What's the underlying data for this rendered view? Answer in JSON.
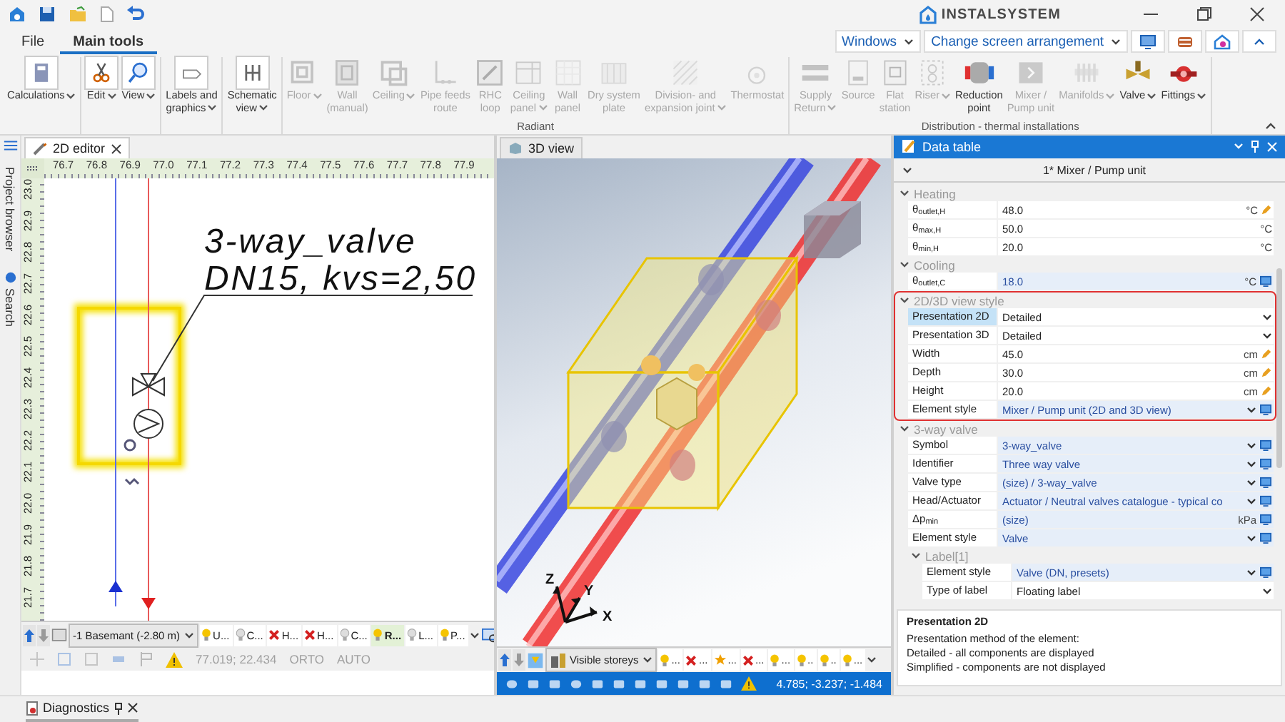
{
  "title_bar": {
    "logo": "INSTALSYSTEM"
  },
  "menu_tabs": [
    {
      "label": "File",
      "selected": false
    },
    {
      "label": "Main tools",
      "selected": true
    }
  ],
  "arrangement": {
    "windows": "Windows",
    "screen": "Change screen arrangement"
  },
  "ribbon": {
    "groups": [
      {
        "buttons": [
          {
            "label": "Calculations",
            "dropdown": true,
            "disabled": false
          }
        ]
      },
      {
        "buttons": [
          {
            "label": "Edit",
            "dropdown": true,
            "disabled": false
          },
          {
            "label": "View",
            "dropdown": true,
            "disabled": false
          }
        ]
      },
      {
        "buttons": [
          {
            "label": "Labels and\ngraphics",
            "dropdown": true,
            "disabled": false
          }
        ]
      },
      {
        "buttons": [
          {
            "label": "Schematic\nview",
            "dropdown": true,
            "disabled": false
          }
        ]
      },
      {
        "label": "Radiant",
        "buttons": [
          {
            "label": "Floor",
            "dropdown": true,
            "disabled": true
          },
          {
            "label": "Wall\n(manual)",
            "dropdown": false,
            "disabled": true
          },
          {
            "label": "Ceiling",
            "dropdown": true,
            "disabled": true
          },
          {
            "label": "Pipe feeds\nroute",
            "dropdown": false,
            "disabled": true
          },
          {
            "label": "RHC\nloop",
            "dropdown": false,
            "disabled": true
          },
          {
            "label": "Ceiling\npanel",
            "dropdown": true,
            "disabled": true
          },
          {
            "label": "Wall\npanel",
            "dropdown": false,
            "disabled": true
          },
          {
            "label": "Dry system\nplate",
            "dropdown": false,
            "disabled": true
          },
          {
            "label": "Division- and\nexpansion joint",
            "dropdown": true,
            "disabled": true
          },
          {
            "label": "Thermostat",
            "dropdown": false,
            "disabled": true
          }
        ]
      },
      {
        "label": "Distribution - thermal installations",
        "buttons": [
          {
            "label": "Supply\nReturn",
            "dropdown": true,
            "disabled": true
          },
          {
            "label": "Source",
            "dropdown": false,
            "disabled": true
          },
          {
            "label": "Flat\nstation",
            "dropdown": false,
            "disabled": true
          },
          {
            "label": "Riser",
            "dropdown": true,
            "disabled": true
          },
          {
            "label": "Reduction\npoint",
            "dropdown": false,
            "disabled": false
          },
          {
            "label": "Mixer /\nPump unit",
            "dropdown": false,
            "disabled": true
          },
          {
            "label": "Manifolds",
            "dropdown": true,
            "disabled": true
          },
          {
            "label": "Valve",
            "dropdown": true,
            "disabled": false
          },
          {
            "label": "Fittings",
            "dropdown": true,
            "disabled": false
          }
        ]
      }
    ]
  },
  "side_tabs": [
    "Project browser",
    "Search"
  ],
  "editor_2d": {
    "tab": "2D editor",
    "x_ruler": [
      "76.7",
      "76.8",
      "76.9",
      "77.0",
      "77.1",
      "77.2",
      "77.3",
      "77.4",
      "77.5",
      "77.6",
      "77.7",
      "77.8",
      "77.9"
    ],
    "y_ruler": [
      "23.0",
      "22.9",
      "22.8",
      "22.7",
      "22.6",
      "22.5",
      "22.4",
      "22.3",
      "22.2",
      "22.1",
      "22.0",
      "21.9",
      "21.8",
      "21.7"
    ],
    "label_lines": [
      "3-way_valve",
      "DN15, kvs=2,50"
    ],
    "storey": "-1 Basemant (-2.80 m)",
    "layers": [
      {
        "label": "U...",
        "kind": "on",
        "selected": false
      },
      {
        "label": "C...",
        "kind": "off",
        "selected": false
      },
      {
        "label": "H...",
        "kind": "hidden",
        "selected": false
      },
      {
        "label": "H...",
        "kind": "hidden",
        "selected": false
      },
      {
        "label": "C...",
        "kind": "off",
        "selected": false
      },
      {
        "label": "R...",
        "kind": "on",
        "selected": true
      },
      {
        "label": "L...",
        "kind": "off",
        "selected": false
      },
      {
        "label": "P...",
        "kind": "on",
        "selected": false
      }
    ],
    "coords": "77.019; 22.434",
    "modes": [
      "ORTO",
      "AUTO"
    ]
  },
  "view_3d": {
    "tab": "3D view",
    "axes": [
      "X",
      "Y",
      "Z"
    ],
    "storeys": "Visible storeys",
    "layers": [
      {
        "label": "...",
        "kind": "on",
        "selected": false
      },
      {
        "label": "...",
        "kind": "hidden",
        "selected": false
      },
      {
        "label": "...",
        "kind": "star",
        "selected": false
      },
      {
        "label": "...",
        "kind": "hidden",
        "selected": false
      },
      {
        "label": "...",
        "kind": "on",
        "selected": false
      },
      {
        "label": "..",
        "kind": "on",
        "selected": false
      },
      {
        "label": "..",
        "kind": "on",
        "selected": false
      },
      {
        "label": "...",
        "kind": "on",
        "selected": false
      }
    ],
    "coords": "4.785; -3.237; -1.484"
  },
  "data_table": {
    "title": "Data table",
    "object": "1* Mixer / Pump unit",
    "sections": [
      {
        "title": "Heating",
        "expanded": true,
        "highlighted": false,
        "items": [
          {
            "kind": "row",
            "label": "θ$_{outlet,H}$",
            "value": "48.0",
            "unit": "°C",
            "editable": true,
            "dropdown": false,
            "linked": false,
            "inherited": false,
            "selected": false
          },
          {
            "kind": "row",
            "label": "θ$_{max,H}$",
            "value": "50.0",
            "unit": "°C",
            "editable": false,
            "dropdown": false,
            "linked": false,
            "inherited": false,
            "selected": false
          },
          {
            "kind": "row",
            "label": "θ$_{min,H}$",
            "value": "20.0",
            "unit": "°C",
            "editable": false,
            "dropdown": false,
            "linked": false,
            "inherited": false,
            "selected": false
          }
        ]
      },
      {
        "title": "Cooling",
        "expanded": true,
        "highlighted": false,
        "items": [
          {
            "kind": "row",
            "label": "θ$_{outlet,C}$",
            "value": "18.0",
            "unit": "°C",
            "editable": false,
            "dropdown": false,
            "linked": true,
            "inherited": true,
            "selected": false
          }
        ]
      },
      {
        "title": "2D/3D view style",
        "expanded": true,
        "highlighted": true,
        "items": [
          {
            "kind": "row",
            "label": "Presentation 2D",
            "value": "Detailed",
            "editable": false,
            "dropdown": true,
            "linked": false,
            "inherited": false,
            "selected": true
          },
          {
            "kind": "row",
            "label": "Presentation 3D",
            "value": "Detailed",
            "editable": false,
            "dropdown": true,
            "linked": false,
            "inherited": false,
            "selected": false
          },
          {
            "kind": "row",
            "label": "Width",
            "value": "45.0",
            "unit": "cm",
            "editable": true,
            "dropdown": false,
            "linked": false,
            "inherited": false,
            "selected": false
          },
          {
            "kind": "row",
            "label": "Depth",
            "value": "30.0",
            "unit": "cm",
            "editable": true,
            "dropdown": false,
            "linked": false,
            "inherited": false,
            "selected": false
          },
          {
            "kind": "row",
            "label": "Height",
            "value": "20.0",
            "unit": "cm",
            "editable": true,
            "dropdown": false,
            "linked": false,
            "inherited": false,
            "selected": false
          },
          {
            "kind": "row",
            "label": "Element style",
            "value": "Mixer / Pump unit  (2D and 3D view)",
            "editable": false,
            "dropdown": true,
            "linked": true,
            "inherited": true,
            "selected": false
          }
        ]
      },
      {
        "title": "3-way valve",
        "expanded": true,
        "highlighted": false,
        "items": [
          {
            "kind": "row",
            "label": "Symbol",
            "value": "3-way_valve",
            "editable": false,
            "dropdown": true,
            "linked": true,
            "inherited": true,
            "selected": false
          },
          {
            "kind": "row",
            "label": "Identifier",
            "value": "Three way valve",
            "editable": false,
            "dropdown": true,
            "linked": true,
            "inherited": true,
            "selected": false
          },
          {
            "kind": "row",
            "label": "Valve type",
            "value": "(size) / 3-way_valve",
            "editable": false,
            "dropdown": true,
            "linked": true,
            "inherited": true,
            "selected": false
          },
          {
            "kind": "row",
            "label": "Head/Actuator",
            "value": "Actuator / Neutral valves catalogue - typical co",
            "editable": false,
            "dropdown": true,
            "linked": true,
            "inherited": true,
            "selected": false
          },
          {
            "kind": "row",
            "label": "Δp$_{min}$",
            "value": "(size)",
            "unit": "kPa",
            "editable": false,
            "dropdown": false,
            "linked": true,
            "inherited": true,
            "selected": false
          },
          {
            "kind": "row",
            "label": "Element style",
            "value": "Valve",
            "editable": false,
            "dropdown": true,
            "linked": true,
            "inherited": true,
            "selected": false
          },
          {
            "kind": "group",
            "title": "Label[1]",
            "expanded": true,
            "children": [
              {
                "kind": "row",
                "label": "Element style",
                "value": "Valve (DN, presets)",
                "editable": false,
                "dropdown": true,
                "linked": true,
                "inherited": true,
                "selected": false
              },
              {
                "kind": "row",
                "label": "Type of label",
                "value": "Floating label",
                "editable": false,
                "dropdown": true,
                "linked": false,
                "inherited": false,
                "selected": false
              }
            ]
          }
        ]
      }
    ],
    "description": {
      "title": "Presentation 2D",
      "lines": [
        "Presentation method of the element:",
        "Detailed - all components are displayed",
        "Simplified -  components are not displayed"
      ]
    }
  },
  "diagnostics": {
    "tab": "Diagnostics"
  }
}
